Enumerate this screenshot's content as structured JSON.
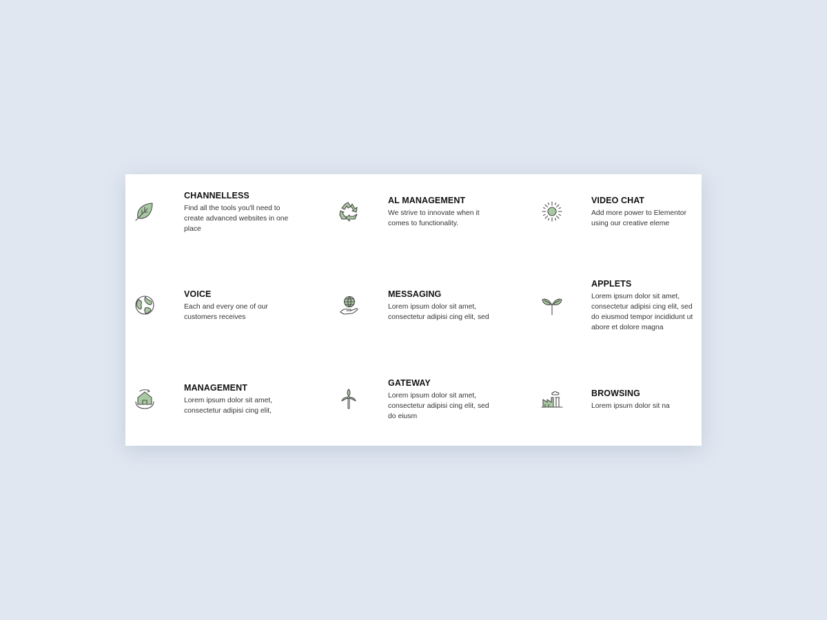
{
  "colors": {
    "page_background": "#e0e7f1",
    "card_background": "#ffffff",
    "icon_fill": "#a9c9a2",
    "icon_stroke": "#4a4a4a",
    "title_color": "#111111",
    "text_color": "#333333"
  },
  "features": [
    {
      "title": "CHANNELLESS",
      "description": "Find all the tools you'll need to create advanced websites in one place",
      "icon": "leaf-icon"
    },
    {
      "title": "AL MANAGEMENT",
      "description": "We strive to innovate when it comes to functionality.",
      "icon": "recycle-icon"
    },
    {
      "title": "VIDEO CHAT",
      "description": "Add more power to Elementor using our creative eleme",
      "icon": "sun-icon"
    },
    {
      "title": "VOICE",
      "description": "Each and every one of our customers receives",
      "icon": "globe-icon"
    },
    {
      "title": "MESSAGING",
      "description": "Lorem ipsum dolor sit amet, consectetur adipisi cing elit, sed",
      "icon": "globe-in-hand-icon"
    },
    {
      "title": "APPLETS",
      "description": "Lorem ipsum dolor sit amet, consectetur adipisi cing elit, sed do eiusmod tempor incididunt ut abore et dolore magna",
      "icon": "sprout-icon"
    },
    {
      "title": "MANAGEMENT",
      "description": "Lorem ipsum dolor sit amet, consectetur adipisi cing elit,",
      "icon": "eco-house-icon"
    },
    {
      "title": "GATEWAY",
      "description": "Lorem ipsum dolor sit amet, consectetur adipisi cing elit, sed do eiusm",
      "icon": "wind-turbine-icon"
    },
    {
      "title": "BROWSING",
      "description": "Lorem ipsum dolor sit na",
      "icon": "factory-icon"
    }
  ]
}
